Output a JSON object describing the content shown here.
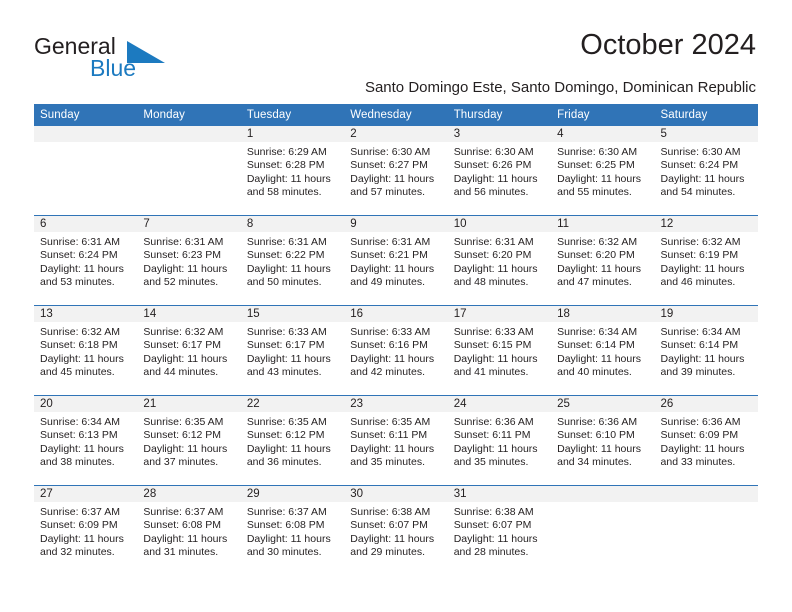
{
  "brand": {
    "name_part1": "General",
    "name_part2": "Blue",
    "mark": "triangle-logo"
  },
  "header": {
    "title": "October 2024",
    "subtitle": "Santo Domingo Este, Santo Domingo, Dominican Republic"
  },
  "colors": {
    "header_blue": "#3074b7",
    "brand_blue": "#1c7ac0",
    "daynum_band": "#f2f2f2",
    "text": "#231f20"
  },
  "weekday_headers": [
    "Sunday",
    "Monday",
    "Tuesday",
    "Wednesday",
    "Thursday",
    "Friday",
    "Saturday"
  ],
  "weeks": [
    [
      {
        "day": "",
        "sunrise": "",
        "sunset": "",
        "daylight1": "",
        "daylight2": ""
      },
      {
        "day": "",
        "sunrise": "",
        "sunset": "",
        "daylight1": "",
        "daylight2": ""
      },
      {
        "day": "1",
        "sunrise": "Sunrise: 6:29 AM",
        "sunset": "Sunset: 6:28 PM",
        "daylight1": "Daylight: 11 hours",
        "daylight2": "and 58 minutes."
      },
      {
        "day": "2",
        "sunrise": "Sunrise: 6:30 AM",
        "sunset": "Sunset: 6:27 PM",
        "daylight1": "Daylight: 11 hours",
        "daylight2": "and 57 minutes."
      },
      {
        "day": "3",
        "sunrise": "Sunrise: 6:30 AM",
        "sunset": "Sunset: 6:26 PM",
        "daylight1": "Daylight: 11 hours",
        "daylight2": "and 56 minutes."
      },
      {
        "day": "4",
        "sunrise": "Sunrise: 6:30 AM",
        "sunset": "Sunset: 6:25 PM",
        "daylight1": "Daylight: 11 hours",
        "daylight2": "and 55 minutes."
      },
      {
        "day": "5",
        "sunrise": "Sunrise: 6:30 AM",
        "sunset": "Sunset: 6:24 PM",
        "daylight1": "Daylight: 11 hours",
        "daylight2": "and 54 minutes."
      }
    ],
    [
      {
        "day": "6",
        "sunrise": "Sunrise: 6:31 AM",
        "sunset": "Sunset: 6:24 PM",
        "daylight1": "Daylight: 11 hours",
        "daylight2": "and 53 minutes."
      },
      {
        "day": "7",
        "sunrise": "Sunrise: 6:31 AM",
        "sunset": "Sunset: 6:23 PM",
        "daylight1": "Daylight: 11 hours",
        "daylight2": "and 52 minutes."
      },
      {
        "day": "8",
        "sunrise": "Sunrise: 6:31 AM",
        "sunset": "Sunset: 6:22 PM",
        "daylight1": "Daylight: 11 hours",
        "daylight2": "and 50 minutes."
      },
      {
        "day": "9",
        "sunrise": "Sunrise: 6:31 AM",
        "sunset": "Sunset: 6:21 PM",
        "daylight1": "Daylight: 11 hours",
        "daylight2": "and 49 minutes."
      },
      {
        "day": "10",
        "sunrise": "Sunrise: 6:31 AM",
        "sunset": "Sunset: 6:20 PM",
        "daylight1": "Daylight: 11 hours",
        "daylight2": "and 48 minutes."
      },
      {
        "day": "11",
        "sunrise": "Sunrise: 6:32 AM",
        "sunset": "Sunset: 6:20 PM",
        "daylight1": "Daylight: 11 hours",
        "daylight2": "and 47 minutes."
      },
      {
        "day": "12",
        "sunrise": "Sunrise: 6:32 AM",
        "sunset": "Sunset: 6:19 PM",
        "daylight1": "Daylight: 11 hours",
        "daylight2": "and 46 minutes."
      }
    ],
    [
      {
        "day": "13",
        "sunrise": "Sunrise: 6:32 AM",
        "sunset": "Sunset: 6:18 PM",
        "daylight1": "Daylight: 11 hours",
        "daylight2": "and 45 minutes."
      },
      {
        "day": "14",
        "sunrise": "Sunrise: 6:32 AM",
        "sunset": "Sunset: 6:17 PM",
        "daylight1": "Daylight: 11 hours",
        "daylight2": "and 44 minutes."
      },
      {
        "day": "15",
        "sunrise": "Sunrise: 6:33 AM",
        "sunset": "Sunset: 6:17 PM",
        "daylight1": "Daylight: 11 hours",
        "daylight2": "and 43 minutes."
      },
      {
        "day": "16",
        "sunrise": "Sunrise: 6:33 AM",
        "sunset": "Sunset: 6:16 PM",
        "daylight1": "Daylight: 11 hours",
        "daylight2": "and 42 minutes."
      },
      {
        "day": "17",
        "sunrise": "Sunrise: 6:33 AM",
        "sunset": "Sunset: 6:15 PM",
        "daylight1": "Daylight: 11 hours",
        "daylight2": "and 41 minutes."
      },
      {
        "day": "18",
        "sunrise": "Sunrise: 6:34 AM",
        "sunset": "Sunset: 6:14 PM",
        "daylight1": "Daylight: 11 hours",
        "daylight2": "and 40 minutes."
      },
      {
        "day": "19",
        "sunrise": "Sunrise: 6:34 AM",
        "sunset": "Sunset: 6:14 PM",
        "daylight1": "Daylight: 11 hours",
        "daylight2": "and 39 minutes."
      }
    ],
    [
      {
        "day": "20",
        "sunrise": "Sunrise: 6:34 AM",
        "sunset": "Sunset: 6:13 PM",
        "daylight1": "Daylight: 11 hours",
        "daylight2": "and 38 minutes."
      },
      {
        "day": "21",
        "sunrise": "Sunrise: 6:35 AM",
        "sunset": "Sunset: 6:12 PM",
        "daylight1": "Daylight: 11 hours",
        "daylight2": "and 37 minutes."
      },
      {
        "day": "22",
        "sunrise": "Sunrise: 6:35 AM",
        "sunset": "Sunset: 6:12 PM",
        "daylight1": "Daylight: 11 hours",
        "daylight2": "and 36 minutes."
      },
      {
        "day": "23",
        "sunrise": "Sunrise: 6:35 AM",
        "sunset": "Sunset: 6:11 PM",
        "daylight1": "Daylight: 11 hours",
        "daylight2": "and 35 minutes."
      },
      {
        "day": "24",
        "sunrise": "Sunrise: 6:36 AM",
        "sunset": "Sunset: 6:11 PM",
        "daylight1": "Daylight: 11 hours",
        "daylight2": "and 35 minutes."
      },
      {
        "day": "25",
        "sunrise": "Sunrise: 6:36 AM",
        "sunset": "Sunset: 6:10 PM",
        "daylight1": "Daylight: 11 hours",
        "daylight2": "and 34 minutes."
      },
      {
        "day": "26",
        "sunrise": "Sunrise: 6:36 AM",
        "sunset": "Sunset: 6:09 PM",
        "daylight1": "Daylight: 11 hours",
        "daylight2": "and 33 minutes."
      }
    ],
    [
      {
        "day": "27",
        "sunrise": "Sunrise: 6:37 AM",
        "sunset": "Sunset: 6:09 PM",
        "daylight1": "Daylight: 11 hours",
        "daylight2": "and 32 minutes."
      },
      {
        "day": "28",
        "sunrise": "Sunrise: 6:37 AM",
        "sunset": "Sunset: 6:08 PM",
        "daylight1": "Daylight: 11 hours",
        "daylight2": "and 31 minutes."
      },
      {
        "day": "29",
        "sunrise": "Sunrise: 6:37 AM",
        "sunset": "Sunset: 6:08 PM",
        "daylight1": "Daylight: 11 hours",
        "daylight2": "and 30 minutes."
      },
      {
        "day": "30",
        "sunrise": "Sunrise: 6:38 AM",
        "sunset": "Sunset: 6:07 PM",
        "daylight1": "Daylight: 11 hours",
        "daylight2": "and 29 minutes."
      },
      {
        "day": "31",
        "sunrise": "Sunrise: 6:38 AM",
        "sunset": "Sunset: 6:07 PM",
        "daylight1": "Daylight: 11 hours",
        "daylight2": "and 28 minutes."
      },
      {
        "day": "",
        "sunrise": "",
        "sunset": "",
        "daylight1": "",
        "daylight2": ""
      },
      {
        "day": "",
        "sunrise": "",
        "sunset": "",
        "daylight1": "",
        "daylight2": ""
      }
    ]
  ]
}
